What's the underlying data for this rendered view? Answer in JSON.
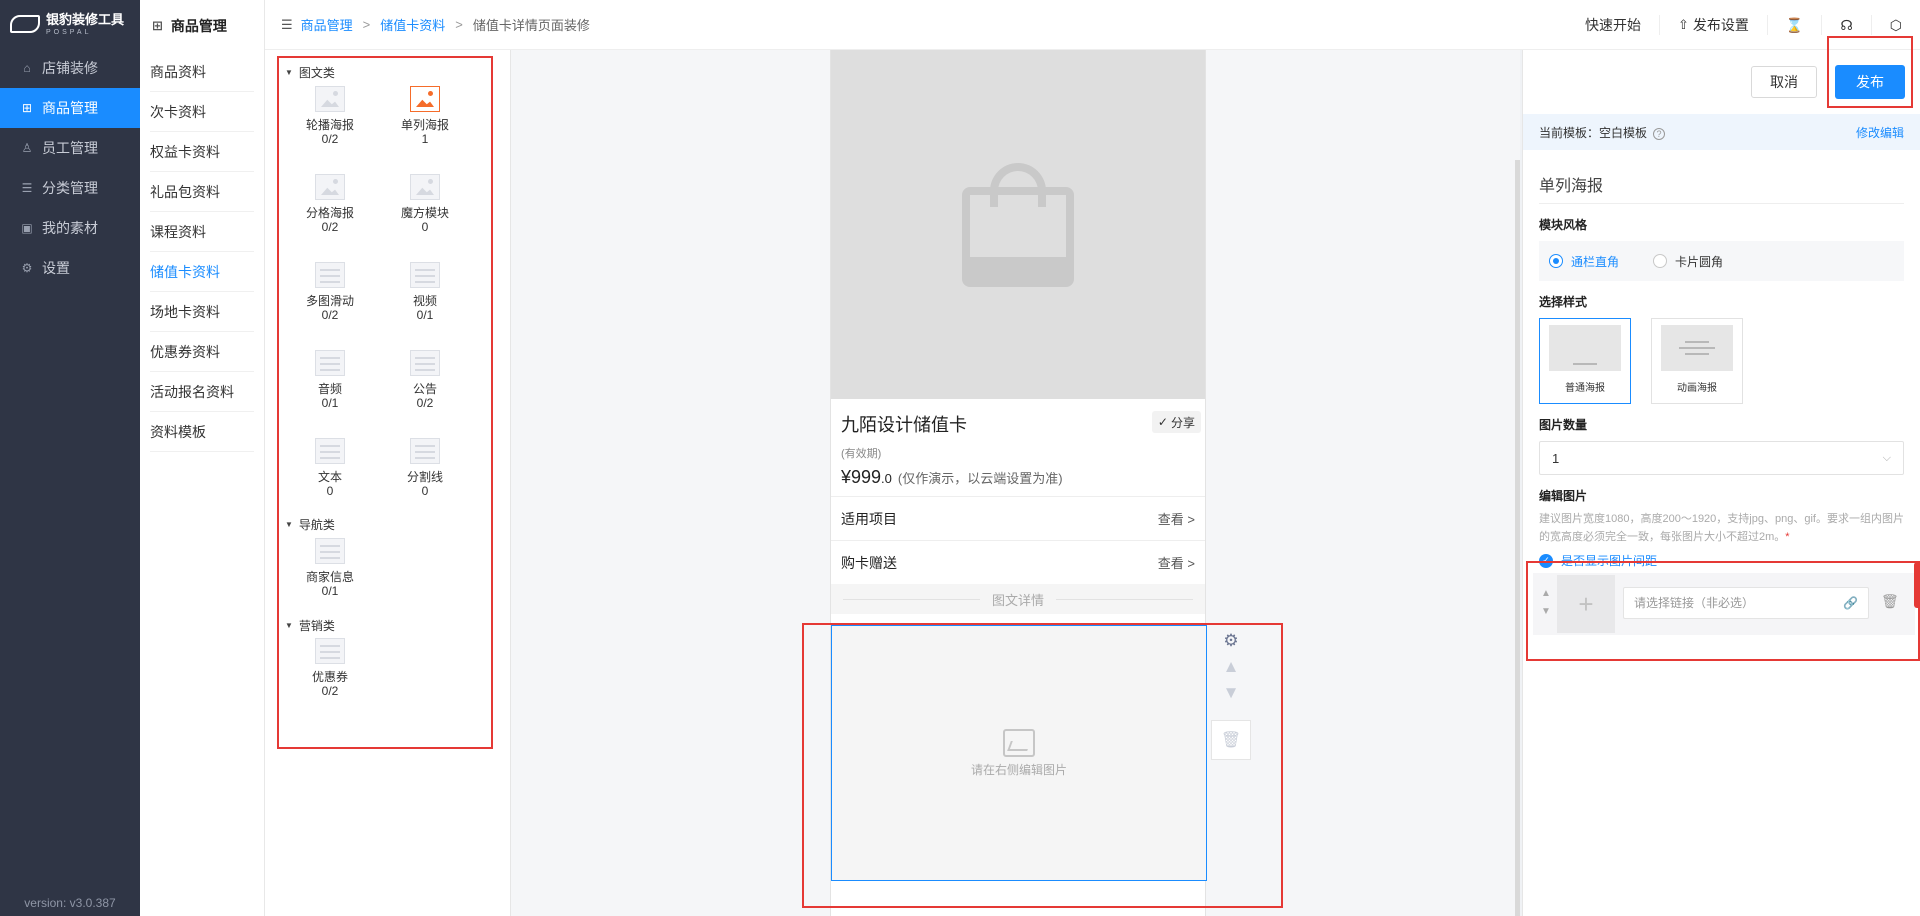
{
  "brand": {
    "name": "银豹装修工具",
    "sub": "POSPAL"
  },
  "sidebar": {
    "items": [
      {
        "icon": "store-icon",
        "glyph": "⌂",
        "label": "店铺装修"
      },
      {
        "icon": "grid-icon",
        "glyph": "⊞",
        "label": "商品管理",
        "active": true
      },
      {
        "icon": "user-icon",
        "glyph": "♙",
        "label": "员工管理"
      },
      {
        "icon": "list-icon",
        "glyph": "☰",
        "label": "分类管理"
      },
      {
        "icon": "image-icon",
        "glyph": "▣",
        "label": "我的素材"
      },
      {
        "icon": "gear-icon",
        "glyph": "⚙",
        "label": "设置"
      }
    ],
    "version": "version: v3.0.387"
  },
  "subnav": {
    "title": "商品管理",
    "items": [
      "商品资料",
      "次卡资料",
      "权益卡资料",
      "礼品包资料",
      "课程资料",
      "储值卡资料",
      "场地卡资料",
      "优惠券资料",
      "活动报名资料",
      "资料模板"
    ],
    "active_index": 5
  },
  "topbar": {
    "crumbs": [
      "商品管理",
      "储值卡资料",
      "储值卡详情页面装修"
    ],
    "sep": ">",
    "quick_start": "快速开始",
    "publish_settings": "发布设置"
  },
  "components": {
    "groups": {
      "graphic": "图文类",
      "nav": "导航类",
      "marketing": "营销类"
    },
    "items": [
      {
        "label": "轮播海报",
        "count": "0/2",
        "icon": "carousel-poster-icon"
      },
      {
        "label": "单列海报",
        "count": "1",
        "icon": "single-poster-icon",
        "highlight": true
      },
      {
        "label": "分格海报",
        "count": "0/2",
        "icon": "grid-poster-icon"
      },
      {
        "label": "魔方模块",
        "count": "0",
        "icon": "cube-module-icon"
      },
      {
        "label": "多图滑动",
        "count": "0/2",
        "icon": "multi-slide-icon"
      },
      {
        "label": "视频",
        "count": "0/1",
        "icon": "video-icon"
      },
      {
        "label": "音频",
        "count": "0/1",
        "icon": "audio-icon"
      },
      {
        "label": "公告",
        "count": "0/2",
        "icon": "notice-icon"
      },
      {
        "label": "文本",
        "count": "0",
        "icon": "text-icon"
      },
      {
        "label": "分割线",
        "count": "0",
        "icon": "divider-icon"
      },
      {
        "label": "商家信息",
        "count": "0/1",
        "icon": "merchant-info-icon"
      },
      {
        "label": "优惠券",
        "count": "0/2",
        "icon": "coupon-icon"
      }
    ]
  },
  "preview": {
    "title": "九陌设计储值卡",
    "share": "分享",
    "validity": "(有效期)",
    "price_main": "¥999",
    "price_dec": ".0",
    "price_note": "(仅作演示，以云端设置为准)",
    "rows": [
      {
        "label": "适用项目",
        "action": "查看 >"
      },
      {
        "label": "购卡赠送",
        "action": "查看 >"
      }
    ],
    "detail_divider": "图文详情",
    "placeholder": "请在右侧编辑图片"
  },
  "settings": {
    "cancel": "取消",
    "publish": "发布",
    "template_label": "当前模板：空白模板",
    "template_edit": "修改编辑",
    "section_title": "单列海报",
    "module_style_label": "模块风格",
    "style_options": [
      "通栏直角",
      "卡片圆角"
    ],
    "style_selected": 0,
    "choose_style_label": "选择样式",
    "style_cards": [
      "普通海报",
      "动画海报"
    ],
    "style_card_selected": 0,
    "image_count_label": "图片数量",
    "image_count_value": "1",
    "edit_image_label": "编辑图片",
    "hint": "建议图片宽度1080，高度200～1920，支持jpg、png、gif。要求一组内图片的宽高度必须完全一致，每张图片大小不超过2m。",
    "hint_star": "*",
    "show_gap_label": "是否显示图片间距",
    "link_placeholder": "请选择链接（非必选）"
  },
  "colors": {
    "accent": "#1a8cff",
    "sidebar": "#2f3545",
    "highlight_red": "#e53935",
    "poster_orange": "#f56c2a"
  }
}
